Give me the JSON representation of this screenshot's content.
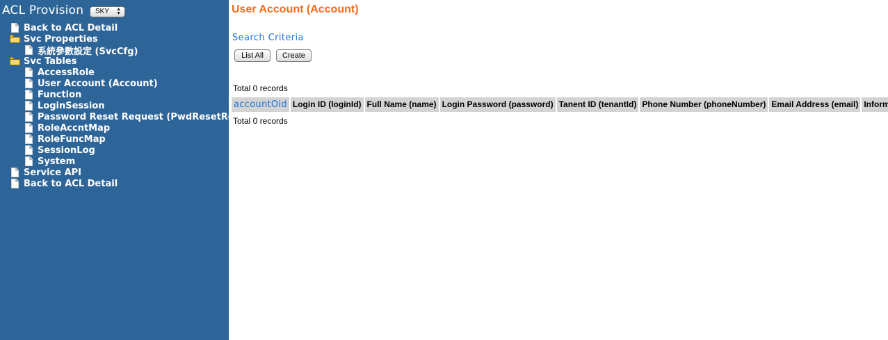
{
  "sidebar": {
    "title": "ACL Provision",
    "env_select": {
      "value": "SKY"
    },
    "items": [
      {
        "label": "Back to ACL Detail",
        "icon": "document-icon",
        "level": 0
      },
      {
        "label": "Svc Properties",
        "icon": "folder-open-icon",
        "level": 0
      },
      {
        "label": "系統參數設定 (SvcCfg)",
        "icon": "document-icon",
        "level": 1
      },
      {
        "label": "Svc Tables",
        "icon": "folder-open-icon",
        "level": 0
      },
      {
        "label": "AccessRole",
        "icon": "document-icon",
        "level": 1
      },
      {
        "label": "User Account (Account)",
        "icon": "document-icon",
        "level": 1
      },
      {
        "label": "Function",
        "icon": "document-icon",
        "level": 1
      },
      {
        "label": "LoginSession",
        "icon": "document-icon",
        "level": 1
      },
      {
        "label": "Password Reset Request (PwdResetReq)",
        "icon": "document-icon",
        "level": 1
      },
      {
        "label": "RoleAccntMap",
        "icon": "document-icon",
        "level": 1
      },
      {
        "label": "RoleFuncMap",
        "icon": "document-icon",
        "level": 1
      },
      {
        "label": "SessionLog",
        "icon": "document-icon",
        "level": 1
      },
      {
        "label": "System",
        "icon": "document-icon",
        "level": 1
      },
      {
        "label": "Service API",
        "icon": "document-icon",
        "level": 0
      },
      {
        "label": "Back to ACL Detail",
        "icon": "document-icon",
        "level": 0
      }
    ]
  },
  "main": {
    "title": "User Account (Account)",
    "search_criteria": "Search Criteria",
    "buttons": {
      "list_all": "List All",
      "create": "Create"
    },
    "total_top": "Total 0 records",
    "total_bottom": "Total 0 records",
    "columns": [
      "accountOid",
      "Login ID (loginId)",
      "Full Name (name)",
      "Login Password (password)",
      "Tanent ID (tenantId)",
      "Phone Number (phoneNumber)",
      "Email Address (email)",
      "Informati"
    ]
  },
  "colors": {
    "sidebar_bg": "#2e6599",
    "title_orange": "#f26b1d",
    "link_blue": "#1e73d8",
    "header_gray": "#d3d3d3"
  }
}
